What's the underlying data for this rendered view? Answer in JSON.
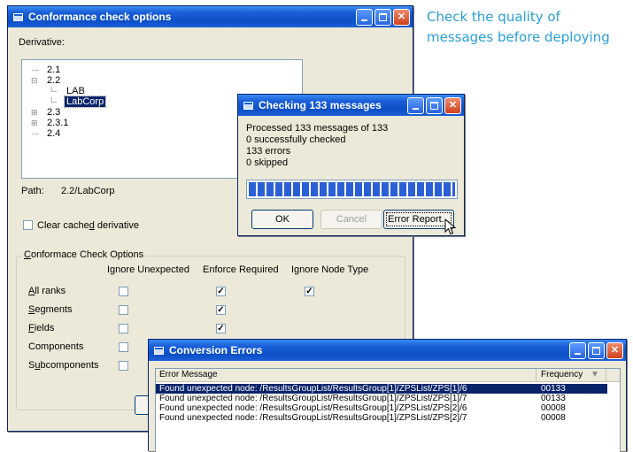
{
  "caption": {
    "line1": "Check the quality of",
    "line2": "messages before deploying"
  },
  "colors": {
    "caption": "#2a9fd8",
    "titlebar": "#1a5fd8",
    "selection": "#0a246a",
    "progress": "#2b5fd6",
    "window_bg": "#ece9d8"
  },
  "options_dialog": {
    "title": "Conformance check options",
    "derivative_label": "Derivative:",
    "tree": [
      {
        "label": "2.1",
        "expander": "",
        "indent": 0
      },
      {
        "label": "2.2",
        "expander": "−",
        "indent": 0
      },
      {
        "label": "LAB",
        "expander": "",
        "indent": 1
      },
      {
        "label": "LabCorp",
        "expander": "",
        "indent": 1,
        "selected": true
      },
      {
        "label": "2.3",
        "expander": "+",
        "indent": 0
      },
      {
        "label": "2.3.1",
        "expander": "+",
        "indent": 0
      },
      {
        "label": "2.4",
        "expander": "",
        "indent": 0
      }
    ],
    "path_label": "Path:",
    "path_value": "2.2/LabCorp",
    "clear_cache_label": "Clear cached derivative",
    "group_title": "Conformace Check Options",
    "columns": [
      "Ignore Unexpected",
      "Enforce Required",
      "Ignore Node Type"
    ],
    "rows": [
      {
        "label": "All ranks",
        "checks": [
          false,
          true,
          true
        ]
      },
      {
        "label": "Segments",
        "checks": [
          false,
          true,
          null
        ]
      },
      {
        "label": "Fields",
        "checks": [
          false,
          true,
          null
        ]
      },
      {
        "label": "Components",
        "checks": [
          false,
          null,
          null
        ]
      },
      {
        "label": "Subcomponents",
        "checks": [
          false,
          null,
          null
        ]
      }
    ]
  },
  "checking_dialog": {
    "title": "Checking 133 messages",
    "processed": "Processed 133 messages of 133",
    "success": "0 successfully checked",
    "errors": "133 errors",
    "skipped": "0 skipped",
    "progress_fraction": 1.0,
    "ok_label": "OK",
    "cancel_label": "Cancel",
    "report_label": "Error Report..."
  },
  "errors_dialog": {
    "title": "Conversion Errors",
    "col_message": "Error Message",
    "col_frequency": "Frequency",
    "rows": [
      {
        "message": "Found unexpected node: /ResultsGroupList/ResultsGroup[1]/ZPSList/ZPS[1]/6",
        "frequency": "00133",
        "selected": true
      },
      {
        "message": "Found unexpected node: /ResultsGroupList/ResultsGroup[1]/ZPSList/ZPS[1]/7",
        "frequency": "00133"
      },
      {
        "message": "Found unexpected node: /ResultsGroupList/ResultsGroup[1]/ZPSList/ZPS[2]/6",
        "frequency": "00008"
      },
      {
        "message": "Found unexpected node: /ResultsGroupList/ResultsGroup[1]/ZPSList/ZPS[2]/7",
        "frequency": "00008"
      }
    ]
  }
}
